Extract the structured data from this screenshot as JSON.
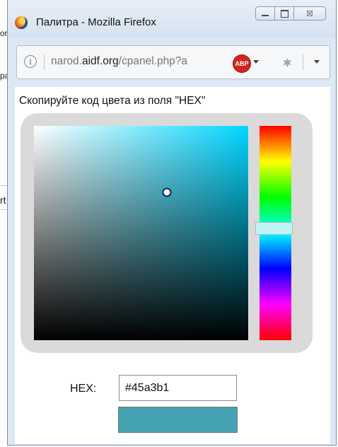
{
  "background_page": {
    "fragments": [
      "or",
      "pa",
      "rt"
    ]
  },
  "window": {
    "title": "Палитра - Mozilla Firefox",
    "minimize_icon": "minimize-icon",
    "maximize_icon": "restore-icon",
    "close_glyph": "☒"
  },
  "urlbar": {
    "info_icon": "i",
    "url_prefix": "narod.",
    "url_domain": "aidf.org",
    "url_suffix": "/cpanel.php?a",
    "adblock_label": "ABP"
  },
  "content": {
    "instruction": "Скопируйте код цвета из поля \"HEX\"",
    "hex_label": "HEX:",
    "hex_value": "#45a3b1",
    "swatch_color": "#45a3b1"
  },
  "picker": {
    "hue_color": "#00d7ff",
    "saturation": 0.62,
    "brightness": 0.69,
    "hue_position": 0.48
  }
}
